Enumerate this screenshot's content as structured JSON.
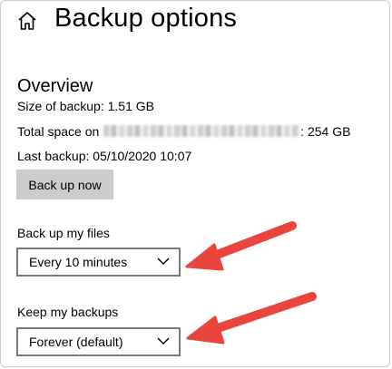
{
  "header": {
    "title": "Backup options"
  },
  "overview": {
    "title": "Overview",
    "size_label": "Size of backup: 1.51 GB",
    "total_space_prefix": "Total space on ",
    "total_space_suffix": ": 254 GB",
    "last_backup_label": "Last backup: 05/10/2020 10:07",
    "backup_now_button": "Back up now"
  },
  "backup_frequency": {
    "label": "Back up my files",
    "selected": "Every 10 minutes"
  },
  "retention": {
    "label": "Keep my backups",
    "selected": "Forever (default)"
  },
  "icons": {
    "home": "home-icon",
    "dropdown": "chevron-down-icon",
    "annotation": "red-arrow-annotation"
  },
  "colors": {
    "button_bg": "#cccccc",
    "dropdown_border": "#7a7a7a",
    "annotation_arrow": "#e8453c"
  }
}
